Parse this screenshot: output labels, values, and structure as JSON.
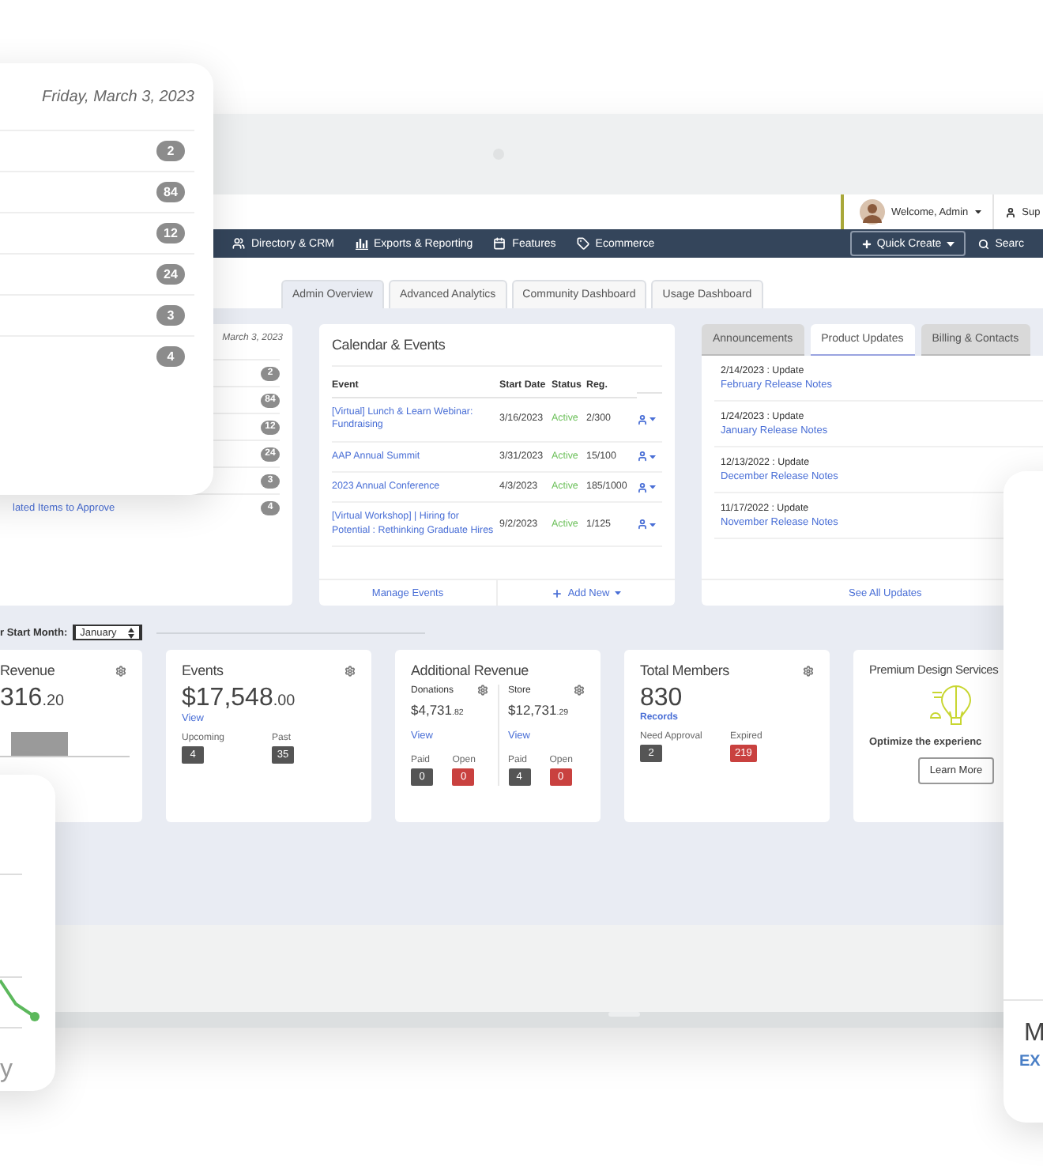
{
  "summary_card": {
    "date": "Friday, March 3, 2023",
    "counts": [
      "2",
      "84",
      "12",
      "24",
      "3",
      "4"
    ]
  },
  "header": {
    "welcome": "Welcome, Admin",
    "support": "Sup"
  },
  "nav": {
    "items": [
      "Directory & CRM",
      "Exports & Reporting",
      "Features",
      "Ecommerce"
    ],
    "quick_create": "Quick Create",
    "search": "Searc"
  },
  "tabs": [
    {
      "label": "Admin Overview",
      "selected": true
    },
    {
      "label": "Advanced Analytics",
      "selected": false
    },
    {
      "label": "Community Dashboard",
      "selected": false
    },
    {
      "label": "Usage Dashboard",
      "selected": false
    }
  ],
  "approvals_panel": {
    "date": "March 3, 2023",
    "rows": [
      {
        "count": "2"
      },
      {
        "count": "84"
      },
      {
        "count": "12"
      },
      {
        "count": "24"
      },
      {
        "count": "3"
      },
      {
        "link": "lated Items to Approve",
        "count": "4"
      }
    ]
  },
  "events_panel": {
    "title": "Calendar & Events",
    "columns": [
      "Event",
      "Start Date",
      "Status",
      "Reg."
    ],
    "rows": [
      {
        "event": "[Virtual] Lunch & Learn Webinar: Fundraising",
        "start": "3/16/2023",
        "status": "Active",
        "reg": "2/300"
      },
      {
        "event": "AAP Annual Summit",
        "start": "3/31/2023",
        "status": "Active",
        "reg": "15/100"
      },
      {
        "event": "2023 Annual Conference",
        "start": "4/3/2023",
        "status": "Active",
        "reg": "185/1000"
      },
      {
        "event": "[Virtual Workshop] | Hiring for Potential : Rethinking Graduate Hires",
        "start": "9/2/2023",
        "status": "Active",
        "reg": "1/125"
      }
    ],
    "footer": {
      "manage": "Manage Events",
      "add": "Add New"
    }
  },
  "updates_panel": {
    "tabs": [
      {
        "label": "Announcements",
        "selected": false
      },
      {
        "label": "Product Updates",
        "selected": true
      },
      {
        "label": "Billing & Contacts",
        "selected": false
      }
    ],
    "items": [
      {
        "date": "2/14/2023 : Update",
        "link": "February Release Notes"
      },
      {
        "date": "1/24/2023 : Update",
        "link": "January Release Notes"
      },
      {
        "date": "12/13/2022 : Update",
        "link": "December Release Notes"
      },
      {
        "date": "11/17/2022 : Update",
        "link": "November Release Notes"
      }
    ],
    "footer": "See All Updates"
  },
  "fiscal": {
    "label": "r Start Month:",
    "value": "January"
  },
  "stats": {
    "revenue": {
      "title": "Revenue",
      "amount": "316",
      "cents": ".20"
    },
    "events": {
      "title": "Events",
      "amount": "$17,548",
      "cents": ".00",
      "link": "View",
      "counts": [
        {
          "label": "Upcoming",
          "value": "4",
          "alert": false
        },
        {
          "label": "Past",
          "value": "35",
          "alert": false
        }
      ]
    },
    "additional": {
      "title": "Additional Revenue",
      "parts": [
        {
          "name": "Donations",
          "amount": "$4,731",
          "cents": ".82",
          "link": "View",
          "counts": [
            {
              "label": "Paid",
              "value": "0",
              "alert": false
            },
            {
              "label": "Open",
              "value": "0",
              "alert": true
            }
          ]
        },
        {
          "name": "Store",
          "amount": "$12,731",
          "cents": ".29",
          "link": "View",
          "counts": [
            {
              "label": "Paid",
              "value": "4",
              "alert": false
            },
            {
              "label": "Open",
              "value": "0",
              "alert": true
            }
          ]
        }
      ]
    },
    "members": {
      "title": "Total Members",
      "amount": "830",
      "link": "Records",
      "counts": [
        {
          "label": "Need Approval",
          "value": "2",
          "alert": false
        },
        {
          "label": "Expired",
          "value": "219",
          "alert": true
        }
      ]
    },
    "promo": {
      "title": "Premium Design Services",
      "text": "Optimize the experienc",
      "button": "Learn More"
    }
  },
  "chart_card": {
    "caption": "y"
  },
  "side_card": {
    "title": "M",
    "link": "EX"
  }
}
